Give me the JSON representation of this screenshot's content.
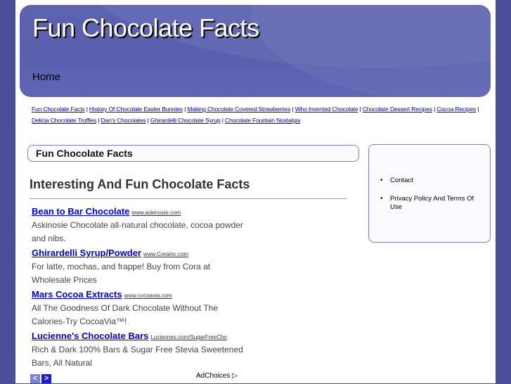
{
  "site": {
    "title": "Fun Chocolate Facts",
    "home": "Home"
  },
  "top_links": [
    "Fun Chocolate Facts",
    "History Of Chocolate Easter Bunnies",
    "Making Chocolate Covered Strawberries",
    "Who Invented Chocolate",
    "Chocolate Dessert Recipes",
    "Cocoa Recipes",
    "Delicia Chocolate Truffles",
    "Dan's Chocolates",
    "Ghirardelli Chocolate Syrup",
    "Chocolate Fountain Nostalgia"
  ],
  "main": {
    "box_title": "Fun Chocolate Facts",
    "heading": "Interesting And Fun Chocolate Facts"
  },
  "ads": [
    {
      "title": "Bean to Bar Chocolate",
      "url": "www.askinosie.com",
      "desc": "Askinosie Chocolate all-natural chocolate, cocoa powder and nibs."
    },
    {
      "title": "Ghirardelli Syrup/Powder",
      "url": "www.Corainc.com",
      "desc": "For latte, mochas, and frappe! Buy from Cora at Wholesale Prices"
    },
    {
      "title": "Mars Cocoa Extracts",
      "url": "www.cocoavia.com",
      "desc": "All The Goodness Of Dark Chocolate Without The Calories-Try CocoaVia™!"
    },
    {
      "title": "Lucienne's Chocolate Bars",
      "url": "Luciennes.com/SugarFreeCho",
      "desc": "Rich & Dark 100% Bars & Sugar Free Stevia Sweetened Bars, All Natural"
    }
  ],
  "ad_controls": {
    "prev": "<",
    "next": ">",
    "adchoices": "AdChoices ▷"
  },
  "sidebar": {
    "items": [
      "Contact",
      "Privacy Policy And Terms Of Use"
    ]
  }
}
